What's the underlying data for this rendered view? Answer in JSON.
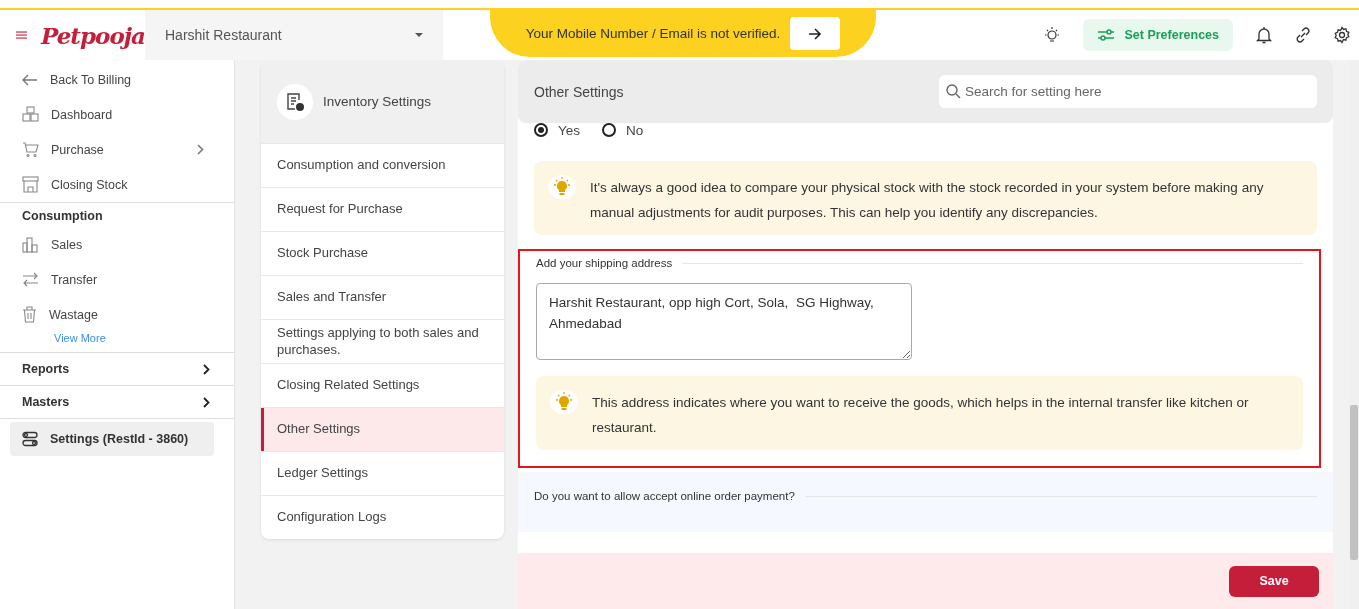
{
  "header": {
    "logo": "Petpooja",
    "restaurant": "Harshit Restaurant",
    "banner": {
      "text": "Your Mobile Number / Email is not verified."
    },
    "preferences_button": "Set Preferences"
  },
  "sidebar": {
    "back": "Back To Billing",
    "items": [
      {
        "label": "Dashboard",
        "expandable": false
      },
      {
        "label": "Purchase",
        "expandable": true
      },
      {
        "label": "Closing Stock",
        "expandable": false
      }
    ],
    "consumption": {
      "title": "Consumption",
      "items": [
        {
          "label": "Sales"
        },
        {
          "label": "Transfer"
        },
        {
          "label": "Wastage"
        }
      ],
      "view_more": "View More"
    },
    "groups": [
      {
        "label": "Reports"
      },
      {
        "label": "Masters"
      }
    ],
    "settings": {
      "label": "Settings (RestId - 3860)",
      "selected": true
    }
  },
  "settings_nav": {
    "title": "Inventory Settings",
    "items": [
      {
        "label": "Consumption and conversion",
        "selected": false
      },
      {
        "label": "Request for Purchase",
        "selected": false
      },
      {
        "label": "Stock Purchase",
        "selected": false
      },
      {
        "label": "Sales and Transfer",
        "selected": false
      },
      {
        "label": "Settings applying to both sales and purchases.",
        "selected": false
      },
      {
        "label": "Closing Related Settings",
        "selected": false
      },
      {
        "label": "Other Settings",
        "selected": true
      },
      {
        "label": "Ledger Settings",
        "selected": false
      },
      {
        "label": "Configuration Logs",
        "selected": false
      }
    ]
  },
  "content": {
    "title": "Other Settings",
    "search": {
      "placeholder": "Search for setting here"
    },
    "options": [
      {
        "label": "Yes",
        "selected": true
      },
      {
        "label": "No",
        "selected": false
      }
    ],
    "tip": "It's always a good idea to compare your physical stock with the stock recorded in your system before making any manual adjustments for audit purposes. This can help you identify any discrepancies.",
    "shipping": {
      "title": "Add your shipping address",
      "highlighted": true,
      "value": "Harshit Restaurant, opp high Cort, Sola,  SG Highway, Ahmedabad",
      "tip": "This address indicates where you want to receive the goods, which helps in the internal transfer like kitchen or restaurant."
    },
    "question": "Do you want to allow accept online order payment?",
    "save": "Save"
  }
}
